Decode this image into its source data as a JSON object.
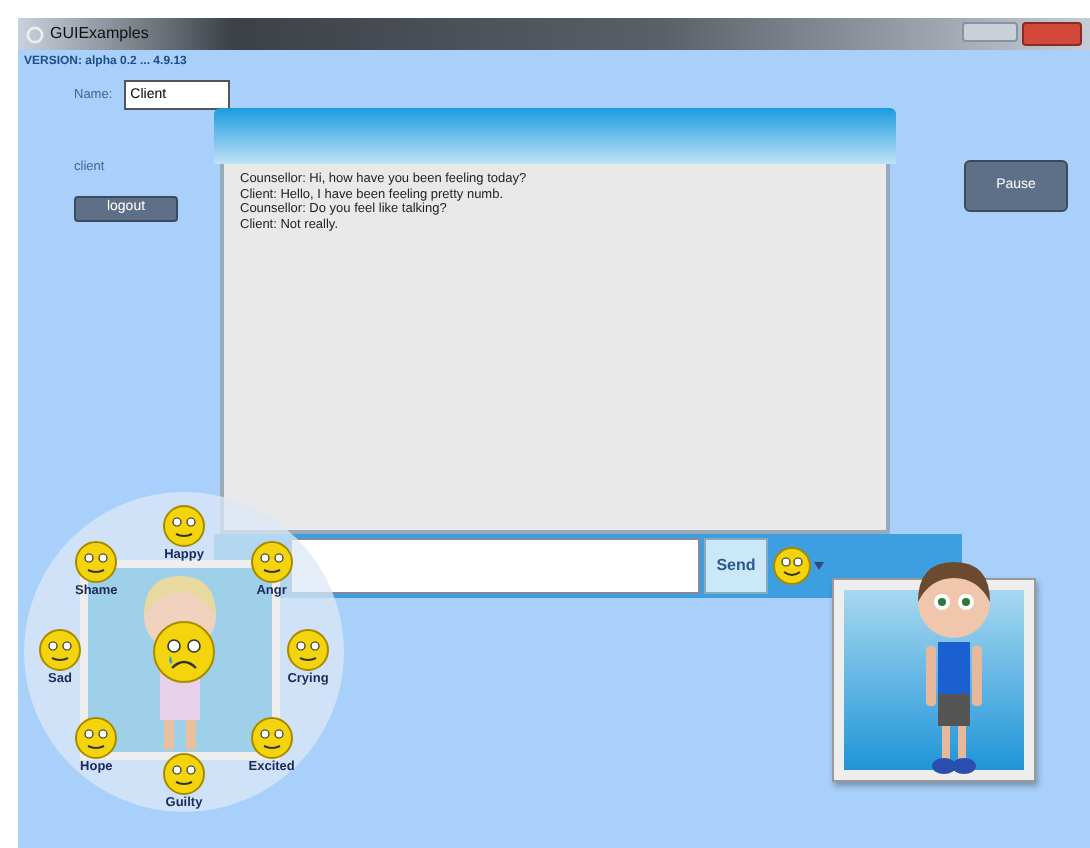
{
  "window": {
    "title": "GUIExamples"
  },
  "version": "VERSION: alpha 0.2 ... 4.9.13",
  "name_field": {
    "label": "Name:",
    "value": "Client"
  },
  "user_label": "client",
  "logout_button": "logout",
  "pause_button": "Pause",
  "chat": {
    "messages": [
      "Counsellor: Hi, how have you been feeling today?",
      "Client: Hello, I have been feeling pretty numb.",
      "Counsellor: Do you feel like talking?",
      "Client: Not really."
    ]
  },
  "message_input": {
    "send_button": "Send"
  },
  "emotion_wheel": {
    "emotions": [
      {
        "label": "Happy"
      },
      {
        "label": "Angr"
      },
      {
        "label": "Crying"
      },
      {
        "label": "Excited"
      },
      {
        "label": "Guilty"
      },
      {
        "label": "Hope"
      },
      {
        "label": "Sad"
      },
      {
        "label": "Shame"
      }
    ]
  }
}
